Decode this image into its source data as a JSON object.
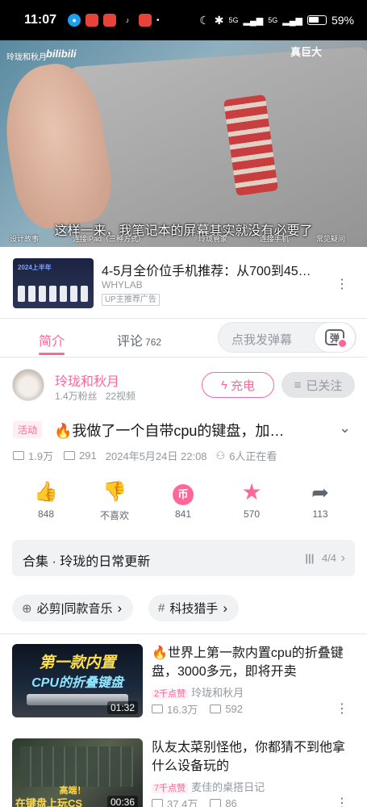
{
  "status_bar": {
    "time": "11:07",
    "signal_a": "5G",
    "signal_b": "5G",
    "battery": "59%"
  },
  "video": {
    "watermark": "玲珑和秋月",
    "logo": "bilibili",
    "top_right_text": "真巨大",
    "subtitle": "这样一来，我笔记本的屏幕其实就没有必要了",
    "chapters": [
      "设计故事",
      "连接iPad（三种方式）",
      "玲珑管家",
      "连接手机",
      "常见疑问"
    ]
  },
  "ad": {
    "title": "4-5月全价位手机推荐：从700到45…",
    "author": "WHYLAB",
    "tag": "UP主推荐广告",
    "thumb_text": "2024上半年"
  },
  "tabs": {
    "intro": "简介",
    "comment": "评论",
    "comment_count": "762",
    "danmaku_placeholder": "点我发弹幕",
    "danmaku_icon_char": "弹"
  },
  "author": {
    "name": "玲珑和秋月",
    "fans": "1.4万粉丝",
    "videos": "22视频",
    "charge_label": "充电",
    "follow_label": "已关注"
  },
  "video_info": {
    "badge": "活动",
    "title": "🔥我做了一个自带cpu的键盘，加…",
    "views": "1.9万",
    "danmaku": "291",
    "date": "2024年5月24日 22:08",
    "watching": "6人正在看"
  },
  "actions": [
    {
      "label": "848",
      "color": "#ff6699"
    },
    {
      "label": "不喜欢",
      "color": "#61666d"
    },
    {
      "label": "841",
      "color": "#ff6699"
    },
    {
      "label": "570",
      "color": "#ff6699"
    },
    {
      "label": "113",
      "color": "#61666d"
    }
  ],
  "collection": {
    "title": "合集 · 玲珑的日常更新",
    "progress": "4/4"
  },
  "tags": [
    {
      "label": "必剪|同款音乐"
    },
    {
      "label": "科技猎手"
    }
  ],
  "recommendations": [
    {
      "thumb_line1": "第一款内置",
      "thumb_line2": "CPU的折叠键盘",
      "duration": "01:32",
      "title": "🔥世界上第一款内置cpu的折叠键盘，3000多元，即将开卖",
      "tag": "2千点赞",
      "author": "玲珑和秋月",
      "views": "16.3万",
      "danmaku": "592"
    },
    {
      "thumb_line1": "高端！",
      "thumb_line2": "在键盘上玩CS",
      "duration": "00:36",
      "title": "队友太菜别怪他，你都猜不到他拿什么设备玩的",
      "tag": "7千点赞",
      "author": "麦佳的桌搭日记",
      "views": "37.4万",
      "danmaku": "86"
    }
  ]
}
